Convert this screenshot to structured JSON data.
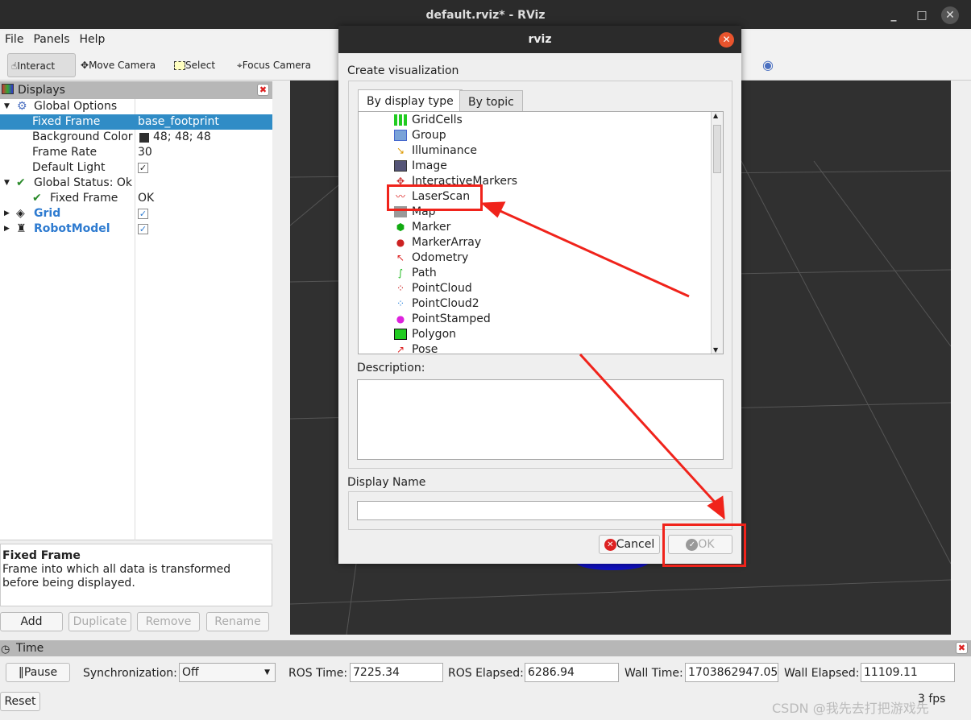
{
  "window": {
    "title": "default.rviz* - RViz",
    "minimize": "_",
    "maximize": "□",
    "close": "✕"
  },
  "menu": [
    "File",
    "Panels",
    "Help"
  ],
  "toolbar": {
    "interact": "Interact",
    "move_camera": "Move Camera",
    "select": "Select",
    "focus_camera": "Focus Camera"
  },
  "displays": {
    "title": "Displays",
    "rows": [
      {
        "key": "Global Options",
        "value": ""
      },
      {
        "key": "Fixed Frame",
        "value": "base_footprint"
      },
      {
        "key": "Background Color",
        "value": "48; 48; 48"
      },
      {
        "key": "Frame Rate",
        "value": "30"
      },
      {
        "key": "Default Light",
        "value": "✓"
      },
      {
        "key": "Global Status: Ok",
        "value": ""
      },
      {
        "key": "Fixed Frame",
        "value": "OK"
      },
      {
        "key": "Grid",
        "value": "✓"
      },
      {
        "key": "RobotModel",
        "value": "✓"
      }
    ],
    "desc_title": "Fixed Frame",
    "desc_text": "Frame into which all data is transformed before being displayed.",
    "buttons": {
      "add": "Add",
      "duplicate": "Duplicate",
      "remove": "Remove",
      "rename": "Rename"
    }
  },
  "time": {
    "title": "Time",
    "pause": "Pause",
    "sync_label": "Synchronization:",
    "sync_value": "Off",
    "ros_time_label": "ROS Time:",
    "ros_time": "7225.34",
    "ros_elapsed_label": "ROS Elapsed:",
    "ros_elapsed": "6286.94",
    "wall_time_label": "Wall Time:",
    "wall_time": "1703862947.05",
    "wall_elapsed_label": "Wall Elapsed:",
    "wall_elapsed": "11109.11",
    "reset": "Reset",
    "fps": "3 fps"
  },
  "watermark": "CSDN @我先去打把游戏先",
  "dialog": {
    "title": "rviz",
    "create_label": "Create visualization",
    "tabs": [
      "By display type",
      "By topic"
    ],
    "items": [
      "GridCells",
      "Group",
      "Illuminance",
      "Image",
      "InteractiveMarkers",
      "LaserScan",
      "Map",
      "Marker",
      "MarkerArray",
      "Odometry",
      "Path",
      "PointCloud",
      "PointCloud2",
      "PointStamped",
      "Polygon",
      "Pose"
    ],
    "description_label": "Description:",
    "display_name_label": "Display Name",
    "display_name_value": "",
    "cancel": "Cancel",
    "ok": "OK"
  },
  "colors": {
    "annotation": "#f0231b",
    "selection": "#308cc6",
    "view_bg": "#303030"
  }
}
